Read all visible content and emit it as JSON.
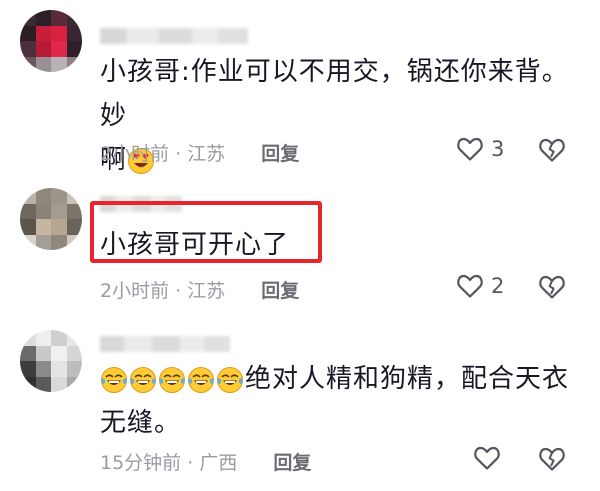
{
  "comments": [
    {
      "text_line1": "小孩哥:作业可以不用交，锅还你来背。妙",
      "text_line2": "啊",
      "emoji_line2": "heart-eyes-emoji",
      "time": "2小时前",
      "location": "江苏",
      "reply_label": "回复",
      "likes": "3"
    },
    {
      "text": "小孩哥可开心了",
      "time": "2小时前",
      "location": "江苏",
      "reply_label": "回复",
      "likes": "2"
    },
    {
      "emoji_prefix": [
        "laughing-tears-emoji",
        "laughing-tears-emoji",
        "laughing-tears-emoji",
        "laughing-tears-emoji",
        "laughing-tears-emoji"
      ],
      "text_line1": "绝对人精和狗精，配合天衣",
      "text_line2": "无缝。",
      "time": "15分钟前",
      "location": "广西",
      "reply_label": "回复",
      "likes": ""
    }
  ],
  "colors": {
    "highlight_box": "#e8252a",
    "meta_text": "#9b9ba2",
    "body_text": "#161823",
    "icon": "#55555c"
  },
  "meta_separator": " · "
}
